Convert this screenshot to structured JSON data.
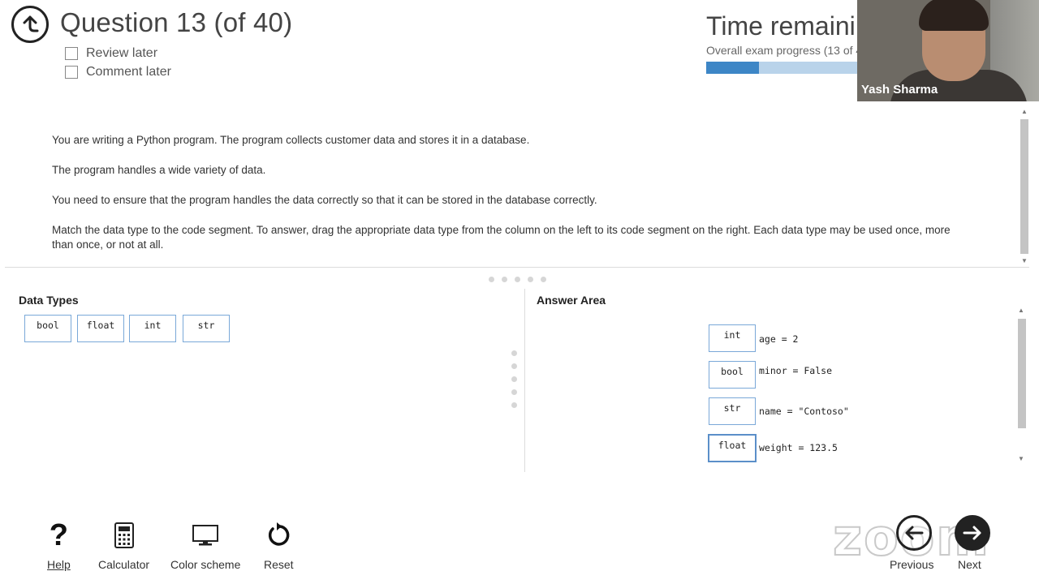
{
  "header": {
    "question_title": "Question 13 (of 40)",
    "review_later": "Review later",
    "comment_later": "Comment later",
    "time_title": "Time remaini",
    "progress_label": "Overall exam progress (13 of 4",
    "progress_fraction": 0.325
  },
  "video": {
    "participant_name": "Yash Sharma"
  },
  "question": {
    "paragraphs": [
      "You are writing a Python program. The program collects customer data and stores it in a database.",
      "The program handles a wide variety of data.",
      "You need to ensure that the program handles the data correctly so that it can be stored in the database correctly.",
      "Match the data type to the code segment. To answer, drag the appropriate data type from the column on the left to its code segment on the right. Each data type may be used once, more than once, or not at all."
    ]
  },
  "data_types": {
    "title": "Data Types",
    "items": [
      "bool",
      "float",
      "int",
      "str"
    ]
  },
  "answer_area": {
    "title": "Answer Area",
    "rows": [
      {
        "answer": "int",
        "code": "age = 2"
      },
      {
        "answer": "bool",
        "code": "minor = False"
      },
      {
        "answer": "str",
        "code": "name = \"Contoso\""
      },
      {
        "answer": "float",
        "code": "weight = 123.5"
      }
    ]
  },
  "toolbar": {
    "help": "Help",
    "calculator": "Calculator",
    "color_scheme": "Color scheme",
    "reset": "Reset",
    "help_glyph": "?",
    "calculator_icon": "calculator-icon",
    "monitor_icon": "monitor-icon",
    "reset_icon": "reset-icon"
  },
  "nav": {
    "previous": "Previous",
    "next": "Next",
    "watermark": "zoom"
  },
  "colors": {
    "accent": "#3d86c6",
    "progress_track": "#b9d3ea",
    "chip_border": "#7aa8d8"
  }
}
